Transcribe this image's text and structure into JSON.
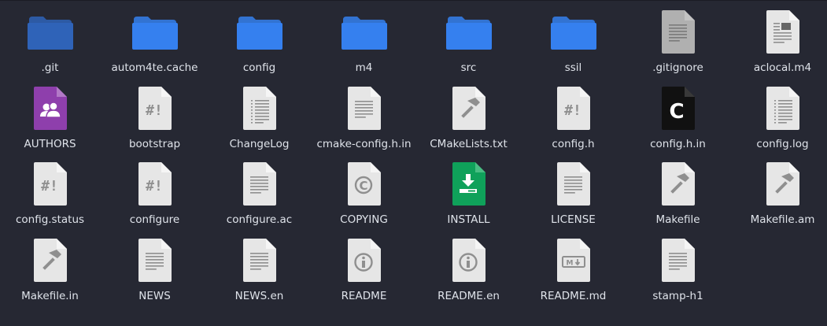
{
  "files": [
    {
      "name": ".git",
      "icon": "folder-dark"
    },
    {
      "name": "autom4te.cache",
      "icon": "folder"
    },
    {
      "name": "config",
      "icon": "folder"
    },
    {
      "name": "m4",
      "icon": "folder"
    },
    {
      "name": "src",
      "icon": "folder"
    },
    {
      "name": "ssil",
      "icon": "folder"
    },
    {
      "name": ".gitignore",
      "icon": "text-dark"
    },
    {
      "name": "aclocal.m4",
      "icon": "document"
    },
    {
      "name": "AUTHORS",
      "icon": "authors"
    },
    {
      "name": "bootstrap",
      "icon": "script"
    },
    {
      "name": "ChangeLog",
      "icon": "list"
    },
    {
      "name": "cmake-config.h.in",
      "icon": "text"
    },
    {
      "name": "CMakeLists.txt",
      "icon": "build"
    },
    {
      "name": "config.h",
      "icon": "script"
    },
    {
      "name": "config.h.in",
      "icon": "c-source"
    },
    {
      "name": "config.log",
      "icon": "list"
    },
    {
      "name": "config.status",
      "icon": "script"
    },
    {
      "name": "configure",
      "icon": "script"
    },
    {
      "name": "configure.ac",
      "icon": "text"
    },
    {
      "name": "COPYING",
      "icon": "copyright"
    },
    {
      "name": "INSTALL",
      "icon": "install"
    },
    {
      "name": "LICENSE",
      "icon": "text"
    },
    {
      "name": "Makefile",
      "icon": "build"
    },
    {
      "name": "Makefile.am",
      "icon": "build"
    },
    {
      "name": "Makefile.in",
      "icon": "build"
    },
    {
      "name": "NEWS",
      "icon": "text"
    },
    {
      "name": "NEWS.en",
      "icon": "text"
    },
    {
      "name": "README",
      "icon": "info"
    },
    {
      "name": "README.en",
      "icon": "info"
    },
    {
      "name": "README.md",
      "icon": "markdown"
    },
    {
      "name": "stamp-h1",
      "icon": "text"
    }
  ],
  "colors": {
    "folder": "#3580ef",
    "folder_dark": "#2f63b8",
    "file": "#e6e6e6",
    "glyph": "#8f8f8f",
    "authors": "#8e3fac",
    "install": "#0fa15a",
    "c_source": "#111111"
  }
}
